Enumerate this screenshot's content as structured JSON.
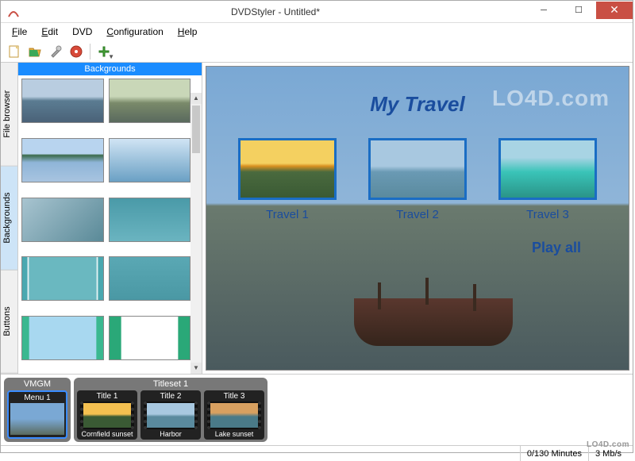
{
  "window": {
    "title": "DVDStyler - Untitled*"
  },
  "menu": {
    "file": "File",
    "edit": "Edit",
    "dvd": "DVD",
    "configuration": "Configuration",
    "help": "Help"
  },
  "side_tabs": {
    "file_browser": "File browser",
    "backgrounds": "Backgrounds",
    "buttons": "Buttons"
  },
  "panel": {
    "header": "Backgrounds"
  },
  "preview": {
    "title": "My Travel",
    "items": [
      {
        "label": "Travel 1"
      },
      {
        "label": "Travel 2"
      },
      {
        "label": "Travel 3"
      }
    ],
    "play_all": "Play all"
  },
  "timeline": {
    "vmgm": "VMGM",
    "menu1": "Menu 1",
    "titleset": "Titleset 1",
    "titles": [
      {
        "header": "Title 1",
        "caption": "Cornfield sunset"
      },
      {
        "header": "Title 2",
        "caption": "Harbor"
      },
      {
        "header": "Title 3",
        "caption": "Lake sunset"
      }
    ]
  },
  "status": {
    "minutes": "0/130 Minutes",
    "bitrate": "3 Mb/s"
  },
  "watermark": "LO4D.com",
  "watermark_corner": "LO4D.com",
  "icons": {
    "new": "new-file",
    "open": "open-folder",
    "save": "save-wrench",
    "burn": "burn-disc",
    "add": "add-plus"
  },
  "thumbnails": {
    "bg_colors": [
      "linear-gradient(to bottom,#b9cde0 40%,#5b7c92 50%,#4a6278 100%)",
      "linear-gradient(to bottom,#c9d7b8 40%,#7a8a6a 55%,#5a6a5e 100%)",
      "linear-gradient(to bottom,#b8d4ef 35%,#3a6a4a 38%,#8fb5d8 55%,#a8c4e0 100%)",
      "linear-gradient(to bottom,#d0e4f4,#6aa0c4)",
      "linear-gradient(135deg,#a8c4d0,#5a8a98)",
      "linear-gradient(to bottom,#4a9aa8,#6ab4c0)",
      "linear-gradient(90deg,#4aa8b0 6%,#fff 7%,#6ab8c0 9%,#6ab8c0 91%,#fff 93%,#4aa8b0 94%)",
      "linear-gradient(to bottom,#5aa8b4,#4a98a4)",
      "linear-gradient(90deg,#3ab890 8%,#a8d8f0 9%,#a8d8f0 91%,#3ab890 92%)",
      "linear-gradient(90deg,#2aa878 14%,#fff 15%,#fff 85%,#2aa878 86%)"
    ]
  },
  "preview_thumbs": [
    "linear-gradient(to bottom,#f4d060 40%,#d89020 45%,#4a6a3e 55%,#3a5a34 100%)",
    "linear-gradient(to bottom,#a8c8e0 45%,#6a9ab4 55%,#5a8a9e 100%)",
    "linear-gradient(to bottom,#a8d4e4 30%,#3ac4b8 55%,#2a9488 100%)"
  ],
  "title_thumbs": [
    "linear-gradient(to bottom,#f4c050 45%,#3a5a34 55%)",
    "linear-gradient(to bottom,#a8c8e0 45%,#5a8a9e 55%)",
    "linear-gradient(to bottom,#d8a060 40%,#4a7a88 55%)"
  ]
}
